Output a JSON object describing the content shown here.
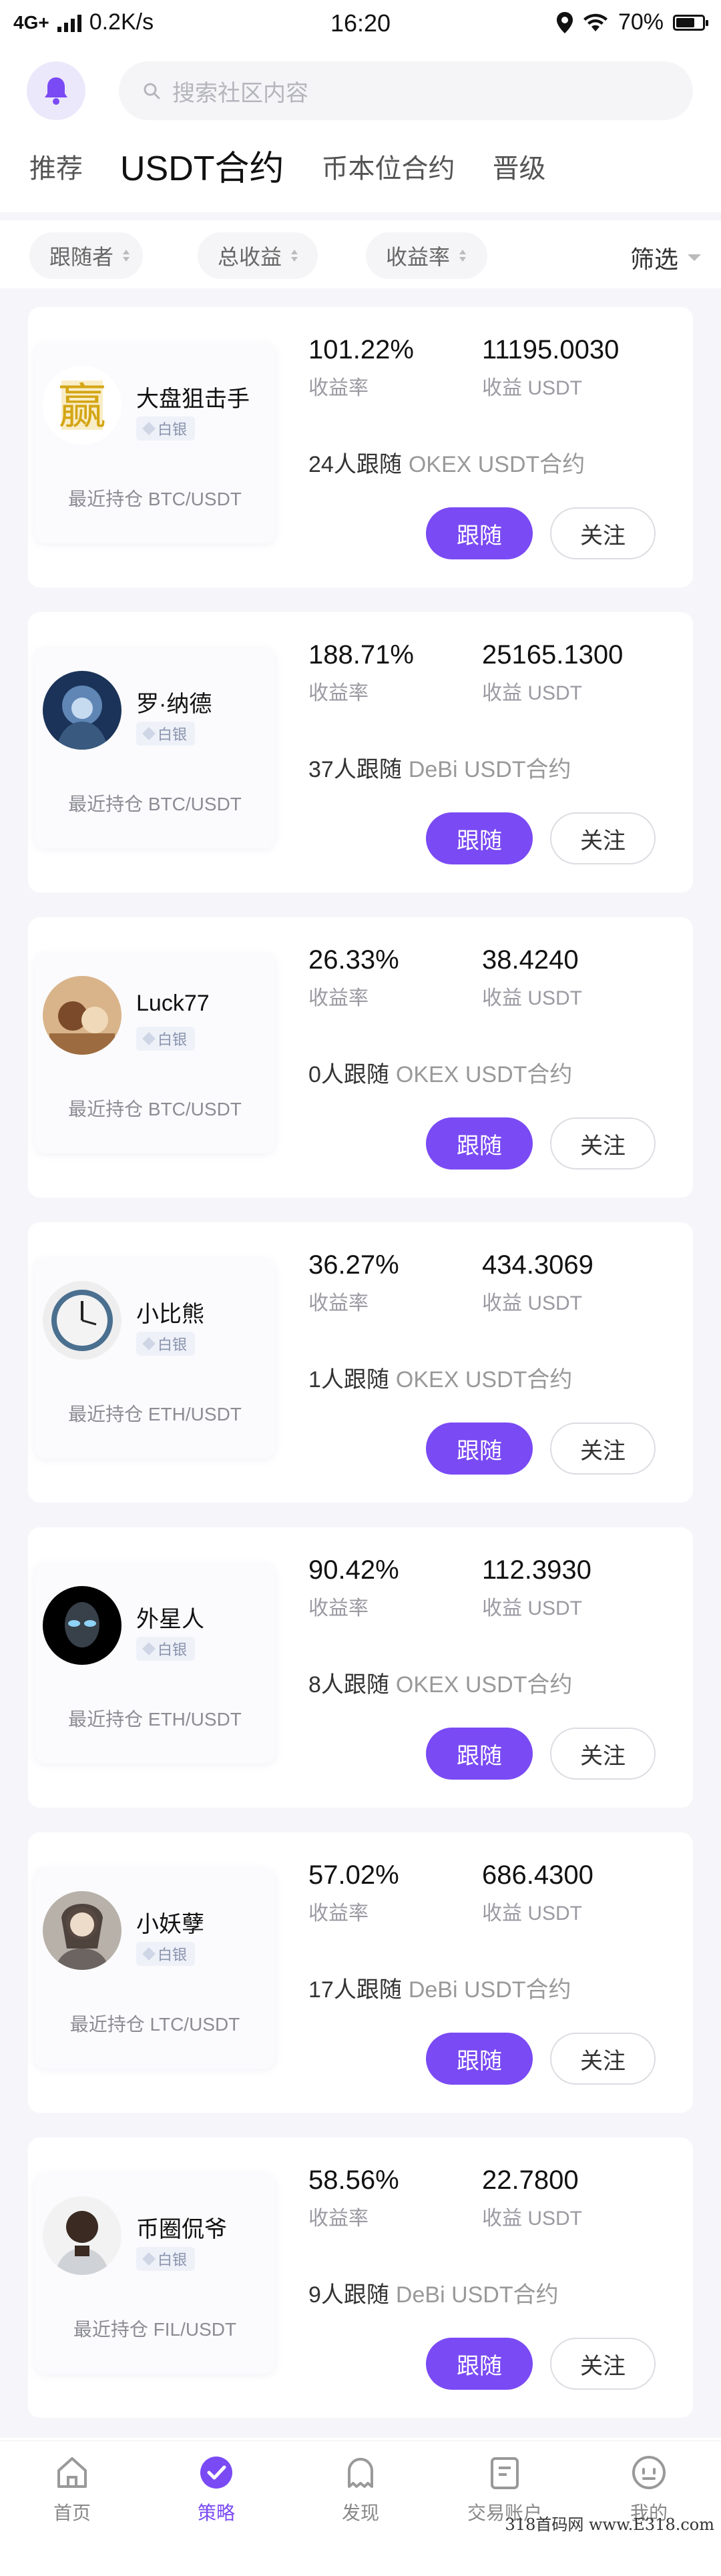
{
  "status_bar": {
    "network": "4G+",
    "speed": "0.2K/s",
    "time": "16:20",
    "battery": "70%",
    "battery_level": 0.7
  },
  "search": {
    "placeholder": "搜索社区内容"
  },
  "tabs": [
    {
      "label": "推荐"
    },
    {
      "label": "USDT合约"
    },
    {
      "label": "币本位合约"
    },
    {
      "label": "晋级"
    }
  ],
  "filters": {
    "sort": [
      "跟随者",
      "总收益",
      "收益率"
    ],
    "filter_label": "筛选"
  },
  "labels": {
    "rate": "收益率",
    "profit": "收益 USDT",
    "follow": "跟随",
    "watch": "关注",
    "badge": "白银"
  },
  "traders": [
    {
      "name": "大盘狙击手",
      "holding": "最近持仓 BTC/USDT",
      "rate": "101.22%",
      "profit": "11195.0030",
      "followers": "24人跟随",
      "exchange": "OKEX USDT合约"
    },
    {
      "name": "罗·纳德",
      "holding": "最近持仓 BTC/USDT",
      "rate": "188.71%",
      "profit": "25165.1300",
      "followers": "37人跟随",
      "exchange": "DeBi USDT合约"
    },
    {
      "name": "Luck77",
      "holding": "最近持仓 BTC/USDT",
      "rate": "26.33%",
      "profit": "38.4240",
      "followers": "0人跟随",
      "exchange": "OKEX USDT合约"
    },
    {
      "name": "小比熊",
      "holding": "最近持仓 ETH/USDT",
      "rate": "36.27%",
      "profit": "434.3069",
      "followers": "1人跟随",
      "exchange": "OKEX USDT合约"
    },
    {
      "name": "外星人",
      "holding": "最近持仓 ETH/USDT",
      "rate": "90.42%",
      "profit": "112.3930",
      "followers": "8人跟随",
      "exchange": "OKEX USDT合约"
    },
    {
      "name": "小妖孽",
      "holding": "最近持仓 LTC/USDT",
      "rate": "57.02%",
      "profit": "686.4300",
      "followers": "17人跟随",
      "exchange": "DeBi USDT合约"
    },
    {
      "name": "币圈侃爷",
      "holding": "最近持仓 FIL/USDT",
      "rate": "58.56%",
      "profit": "22.7800",
      "followers": "9人跟随",
      "exchange": "DeBi USDT合约"
    }
  ],
  "bottom_nav": [
    {
      "label": "首页",
      "icon": "home-icon"
    },
    {
      "label": "策略",
      "icon": "strategy-icon"
    },
    {
      "label": "发现",
      "icon": "discover-icon"
    },
    {
      "label": "交易账户",
      "icon": "account-icon"
    },
    {
      "label": "我的",
      "icon": "profile-icon"
    }
  ],
  "watermark": "318首码网  www.E318.com",
  "colors": {
    "accent": "#7a4af4",
    "background": "#f6f5fa"
  }
}
